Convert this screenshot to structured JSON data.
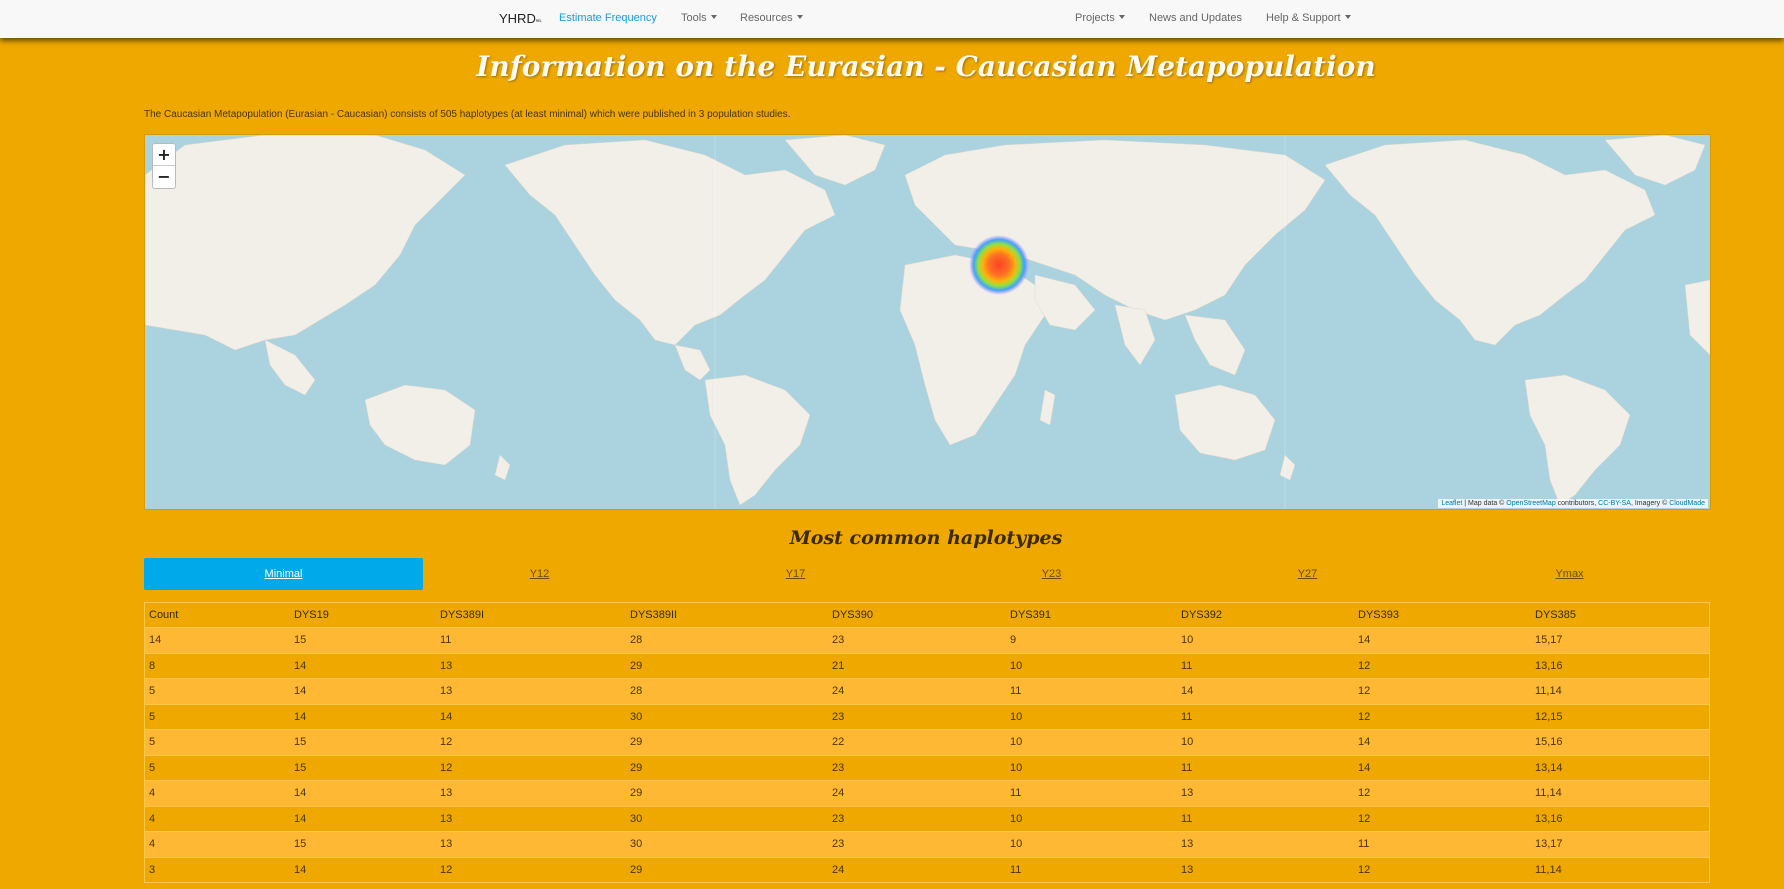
{
  "navbar": {
    "brand": "YHRD",
    "brand_sub": "ᴿᴱᴸ",
    "estimate_frequency": "Estimate Frequency",
    "tools": "Tools",
    "resources": "Resources",
    "projects": "Projects",
    "news": "News and Updates",
    "help": "Help & Support"
  },
  "page": {
    "title": "Information on the Eurasian - Caucasian Metapopulation",
    "description": "The Caucasian Metapopulation (Eurasian - Caucasian) consists of 505 haplotypes (at least minimal) which were published in 3 population studies."
  },
  "map": {
    "zoom_in": "+",
    "zoom_out": "−",
    "attribution": {
      "leaflet": "Leaflet",
      "text1": " | Map data © ",
      "osm": "OpenStreetMap",
      "text2": " contributors, ",
      "license": "CC-BY-SA",
      "text3": ", Imagery © ",
      "imagery": "CloudMade"
    },
    "heatmap_colors": [
      "#ff3a1a",
      "#ffb000",
      "#8fe03a",
      "#33a0ff",
      "#b070ff"
    ]
  },
  "haplotypes": {
    "title": "Most common haplotypes",
    "tabs": [
      "Minimal",
      "Y12",
      "Y17",
      "Y23",
      "Y27",
      "Ymax"
    ],
    "active_tab": "Minimal",
    "columns": [
      "Count",
      "DYS19",
      "DYS389I",
      "DYS389II",
      "DYS390",
      "DYS391",
      "DYS392",
      "DYS393",
      "DYS385"
    ],
    "rows": [
      [
        "14",
        "15",
        "11",
        "28",
        "23",
        "9",
        "10",
        "14",
        "15,17"
      ],
      [
        "8",
        "14",
        "13",
        "29",
        "21",
        "10",
        "11",
        "12",
        "13,16"
      ],
      [
        "5",
        "14",
        "13",
        "28",
        "24",
        "11",
        "14",
        "12",
        "11,14"
      ],
      [
        "5",
        "14",
        "14",
        "30",
        "23",
        "10",
        "11",
        "12",
        "12,15"
      ],
      [
        "5",
        "15",
        "12",
        "29",
        "22",
        "10",
        "10",
        "14",
        "15,16"
      ],
      [
        "5",
        "15",
        "12",
        "29",
        "23",
        "10",
        "11",
        "14",
        "13,14"
      ],
      [
        "4",
        "14",
        "13",
        "29",
        "24",
        "11",
        "13",
        "12",
        "11,14"
      ],
      [
        "4",
        "14",
        "13",
        "30",
        "23",
        "10",
        "11",
        "12",
        "13,16"
      ],
      [
        "4",
        "15",
        "13",
        "30",
        "23",
        "10",
        "13",
        "11",
        "13,17"
      ],
      [
        "3",
        "14",
        "12",
        "29",
        "24",
        "11",
        "13",
        "12",
        "11,14"
      ]
    ]
  }
}
